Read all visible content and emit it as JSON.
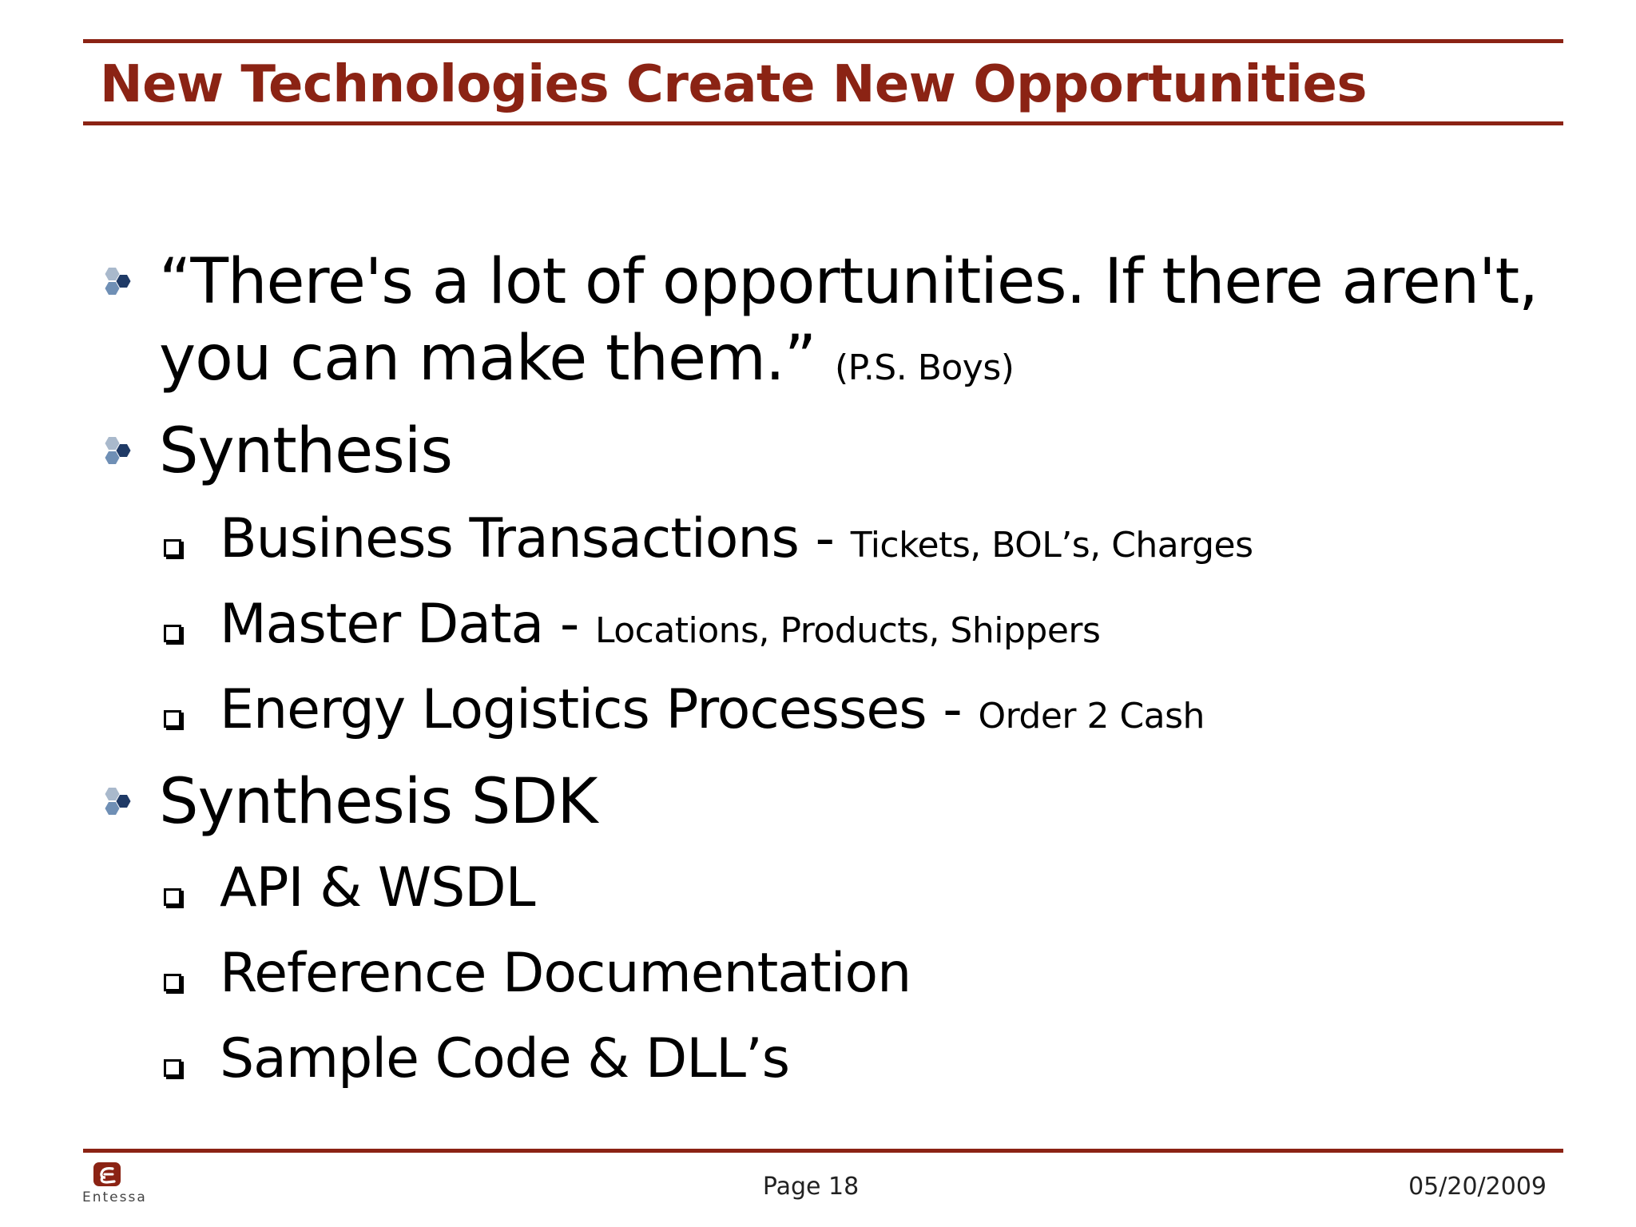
{
  "slide": {
    "title": "New Technologies Create New Opportunities"
  },
  "content": {
    "quote_line1": "“There's a lot of opportunities. If there aren't,",
    "quote_line2": "you can make them.”",
    "quote_attribution": "(P.S. Boys)",
    "synthesis": {
      "label": "Synthesis",
      "items": [
        {
          "main": "Business Transactions - ",
          "detail": "Tickets, BOL’s, Charges"
        },
        {
          "main": "Master Data - ",
          "detail": "Locations, Products, Shippers"
        },
        {
          "main": "Energy Logistics Processes - ",
          "detail": "Order 2 Cash"
        }
      ]
    },
    "sdk": {
      "label": "Synthesis SDK",
      "items": [
        {
          "main": "API & WSDL"
        },
        {
          "main": "Reference Documentation"
        },
        {
          "main": "Sample Code & DLL’s"
        }
      ]
    }
  },
  "footer": {
    "page": "Page 18",
    "date": "05/20/2009",
    "logo_text": "Entessa"
  },
  "colors": {
    "accent": "#8b2314",
    "bullet_light": "#a9b9cc",
    "bullet_mid": "#6f8fb5",
    "bullet_dark": "#1f3a66"
  }
}
